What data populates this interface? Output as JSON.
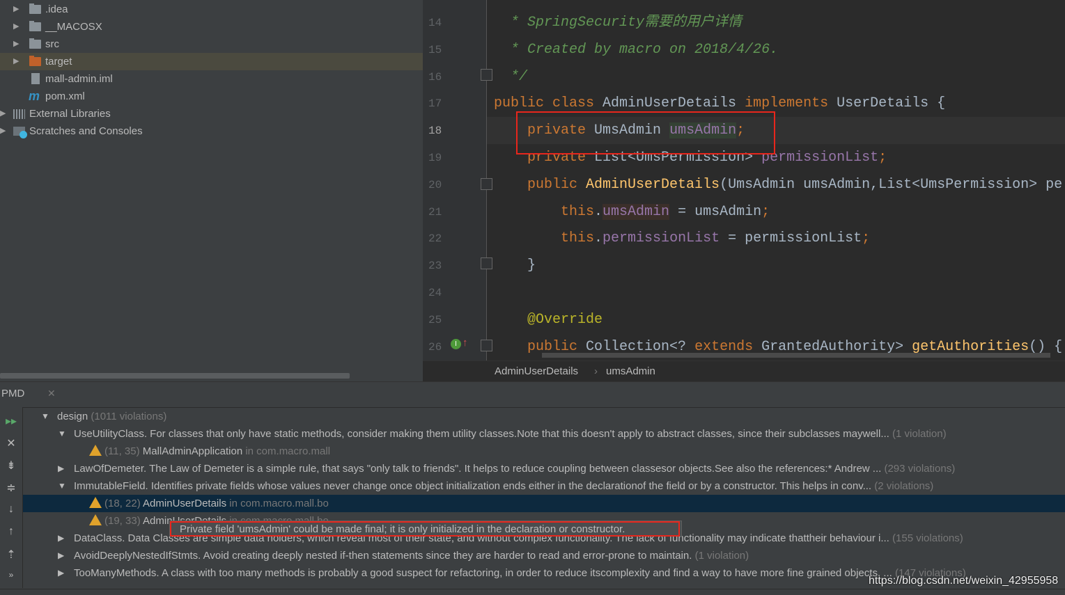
{
  "project_tree": [
    {
      "label": ".idea",
      "icon": "folder-icon",
      "arrow": true,
      "indent": 0
    },
    {
      "label": "__MACOSX",
      "icon": "folder-icon",
      "arrow": true,
      "indent": 0
    },
    {
      "label": "src",
      "icon": "folder-icon",
      "arrow": true,
      "indent": 0
    },
    {
      "label": "target",
      "icon": "folder-excluded-icon",
      "arrow": true,
      "indent": 0,
      "selected": true
    },
    {
      "label": "mall-admin.iml",
      "icon": "iml-file-icon",
      "arrow": false,
      "indent": 0
    },
    {
      "label": "pom.xml",
      "icon": "maven-icon",
      "arrow": false,
      "indent": 0
    },
    {
      "label": "External Libraries",
      "icon": "library-icon",
      "arrow": true,
      "indent": -1
    },
    {
      "label": "Scratches and Consoles",
      "icon": "scratches-icon",
      "arrow": true,
      "indent": -1
    }
  ],
  "editor": {
    "current_line": 18,
    "lines": [
      {
        "n": "14",
        "t": [
          [
            "  * SpringSecurity需要的用户详情",
            "cm"
          ]
        ]
      },
      {
        "n": "15",
        "t": [
          [
            "  * Created by macro on 2018/4/26.",
            "cm"
          ]
        ]
      },
      {
        "n": "16",
        "t": [
          [
            "  */",
            "cm"
          ]
        ]
      },
      {
        "n": "17",
        "t": [
          [
            "public class ",
            "kw"
          ],
          [
            "AdminUserDetails ",
            "ty"
          ],
          [
            "implements ",
            "kw"
          ],
          [
            "UserDetails {",
            "ty"
          ]
        ]
      },
      {
        "n": "18",
        "t": [
          [
            "    private ",
            "kw"
          ],
          [
            "UmsAdmin ",
            "ty"
          ],
          [
            "umsAdmin",
            "fd hl-g"
          ],
          [
            ";",
            "kw"
          ]
        ]
      },
      {
        "n": "19",
        "t": [
          [
            "    private ",
            "kw"
          ],
          [
            "List<UmsPermission> ",
            "ty"
          ],
          [
            "permissionList",
            "fd"
          ],
          [
            ";",
            "kw"
          ]
        ]
      },
      {
        "n": "20",
        "t": [
          [
            "    public ",
            "kw"
          ],
          [
            "AdminUserDetails",
            "fn"
          ],
          [
            "(UmsAdmin umsAdmin,List<UmsPermission> pe",
            "ty"
          ]
        ]
      },
      {
        "n": "21",
        "t": [
          [
            "        this",
            "kw"
          ],
          [
            ".",
            "pl"
          ],
          [
            "umsAdmin",
            "fd hl-b"
          ],
          [
            " = umsAdmin",
            "pl"
          ],
          [
            ";",
            "kw"
          ]
        ]
      },
      {
        "n": "22",
        "t": [
          [
            "        this",
            "kw"
          ],
          [
            ".",
            "pl"
          ],
          [
            "permissionList",
            "fd"
          ],
          [
            " = permissionList",
            "pl"
          ],
          [
            ";",
            "kw"
          ]
        ]
      },
      {
        "n": "23",
        "t": [
          [
            "    }",
            "pl"
          ]
        ]
      },
      {
        "n": "24",
        "t": []
      },
      {
        "n": "25",
        "t": [
          [
            "    @Override",
            "an"
          ]
        ]
      },
      {
        "n": "26",
        "t": [
          [
            "    public ",
            "kw"
          ],
          [
            "Collection<? ",
            "ty"
          ],
          [
            "extends ",
            "kw"
          ],
          [
            "GrantedAuthority> ",
            "ty"
          ],
          [
            "getAuthorities",
            "fn"
          ],
          [
            "() {",
            "pl"
          ]
        ]
      }
    ]
  },
  "breadcrumb": [
    "AdminUserDetails",
    "umsAdmin"
  ],
  "pmd": {
    "title": "PMD",
    "rows": [
      {
        "level": 0,
        "arrow": "down",
        "text": "design",
        "count": "(1011 violations)"
      },
      {
        "level": 1,
        "arrow": "down",
        "text": "UseUtilityClass. For classes that only have static methods, consider making them utility classes.Note that this doesn't apply to abstract classes, since their subclasses maywell...",
        "count": "(1 violation)"
      },
      {
        "level": 2,
        "warn": true,
        "pos": "(11, 35)",
        "text": "MallAdminApplication",
        "count": "in com.macro.mall"
      },
      {
        "level": 1,
        "arrow": "right",
        "text": "LawOfDemeter. The Law of Demeter is a simple rule, that says \"only talk to friends\". It helps to reduce coupling between classesor objects.See also the references:*   Andrew ...",
        "count": "(293 violations)"
      },
      {
        "level": 1,
        "arrow": "down",
        "text": "ImmutableField. Identifies private fields whose values never change once object initialization ends either in the declarationof the field or by a constructor.  This helps in conv...",
        "count": "(2 violations)"
      },
      {
        "level": 2,
        "warn": true,
        "pos": "(18, 22)",
        "text": "AdminUserDetails",
        "count": "in com.macro.mall.bo",
        "selected": true
      },
      {
        "level": 2,
        "warn": true,
        "pos": "(19, 33)",
        "text": "AdminUserDetails",
        "count": "in com.macro.mall.bo"
      },
      {
        "level": 1,
        "arrow": "right",
        "text": "DataClass. Data Classes are simple data holders, which reveal most of their state, and without complex functionality. The lack of functionality may indicate thattheir behaviour i...",
        "count": "(155 violations)"
      },
      {
        "level": 1,
        "arrow": "right",
        "text": "AvoidDeeplyNestedIfStmts. Avoid creating deeply nested if-then statements since they are harder to read and error-prone to maintain.        ",
        "count": "(1 violation)"
      },
      {
        "level": 1,
        "arrow": "right",
        "text": "TooManyMethods. A class with too many methods is probably a good suspect for refactoring, in order to reduce itscomplexity and find a way to have more fine grained objects.     ...",
        "count": "(147 violations)"
      }
    ],
    "tooltip": "Private field 'umsAdmin' could be made final; it is only initialized in the declaration or constructor.",
    "toolbar": [
      "run-icon",
      "close-icon",
      "collapse-all-icon",
      "expand-all-icon",
      "next-icon",
      "previous-icon",
      "export-icon",
      "more-icon"
    ]
  },
  "watermark": "https://blog.csdn.net/weixin_42955958",
  "colors": {
    "highlight_box": "#e8261c",
    "selected_row": "#0d293e",
    "warning": "#e0a22b"
  }
}
